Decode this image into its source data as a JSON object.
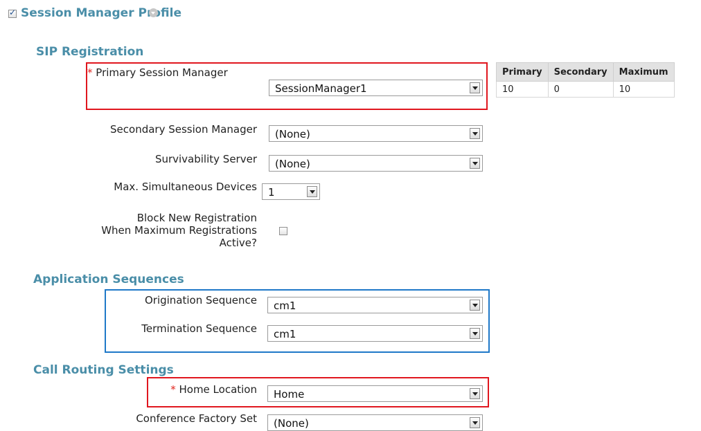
{
  "profile": {
    "title": "Session Manager Profile"
  },
  "sections": {
    "sip": "SIP Registration",
    "app": "Application Sequences",
    "call": "Call Routing Settings"
  },
  "fields": {
    "primary": {
      "label": "Primary Session Manager",
      "value": "SessionManager1"
    },
    "secondary": {
      "label": "Secondary Session Manager",
      "value": "(None)"
    },
    "survivability": {
      "label": "Survivability Server",
      "value": "(None)"
    },
    "max_devices": {
      "label": "Max. Simultaneous Devices",
      "value": "1"
    },
    "block": {
      "line1": "Block New Registration",
      "line2": "When Maximum Registrations",
      "line3": "Active?"
    },
    "origination": {
      "label": "Origination Sequence",
      "value": "cm1"
    },
    "termination": {
      "label": "Termination Sequence",
      "value": "cm1"
    },
    "home": {
      "label": "Home Location",
      "value": "Home"
    },
    "conference": {
      "label": "Conference Factory Set",
      "value": "(None)"
    }
  },
  "required_mark": "*",
  "reg_table": {
    "headers": [
      "Primary",
      "Secondary",
      "Maximum"
    ],
    "row": [
      "10",
      "0",
      "10"
    ]
  }
}
